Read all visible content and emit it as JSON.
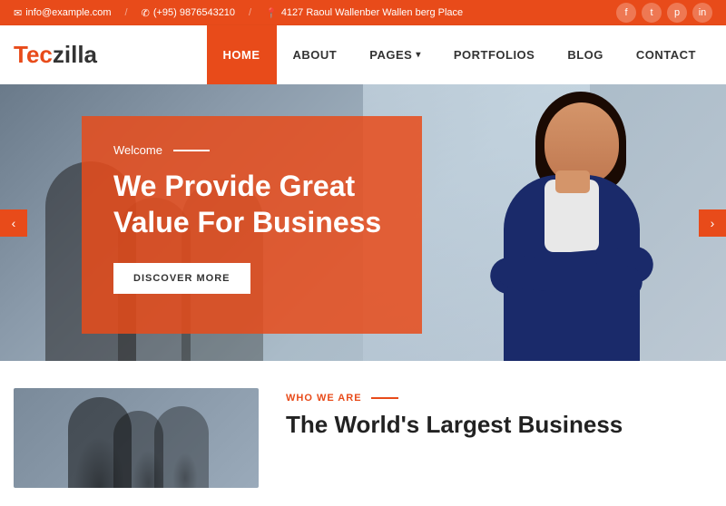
{
  "topbar": {
    "email": "info@example.com",
    "phone": "(+95) 9876543210",
    "address": "4127 Raoul Wallenber Wallen berg Place",
    "email_icon": "✉",
    "phone_icon": "✆",
    "location_icon": "📍",
    "divider": "/"
  },
  "social": {
    "facebook": "f",
    "twitter": "t",
    "pinterest": "p",
    "linkedin": "in"
  },
  "header": {
    "logo_tec": "Tec",
    "logo_zilla": "zilla"
  },
  "nav": {
    "items": [
      {
        "label": "HOME",
        "active": true
      },
      {
        "label": "ABOUT",
        "active": false
      },
      {
        "label": "PAGES",
        "active": false,
        "has_dropdown": true
      },
      {
        "label": "PORTFOLIOS",
        "active": false
      },
      {
        "label": "BLOG",
        "active": false
      },
      {
        "label": "CONTACT",
        "active": false
      }
    ]
  },
  "hero": {
    "welcome": "Welcome",
    "title_line1": "We Provide Great",
    "title_line2": "Value For Business",
    "cta_label": "DISCOVER MORE",
    "arrow_prev": "‹",
    "arrow_next": "›"
  },
  "below": {
    "who_we_are": "WHO WE ARE",
    "title_line1": "The World's Largest Business"
  }
}
